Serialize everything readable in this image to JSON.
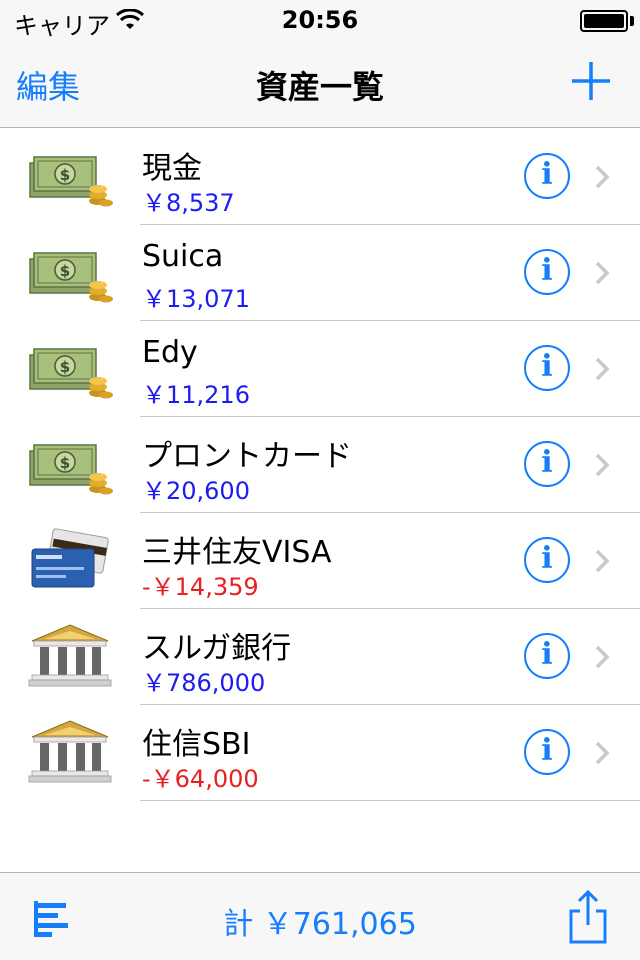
{
  "status_bar": {
    "carrier": "キャリア",
    "time": "20:56"
  },
  "nav": {
    "edit_label": "編集",
    "title": "資産一覧",
    "add_icon": "plus-icon"
  },
  "assets": [
    {
      "name": "現金",
      "amount": "￥8,537",
      "type": "cash",
      "negative": false
    },
    {
      "name": "Suica",
      "amount": "￥13,071",
      "type": "cash",
      "negative": false
    },
    {
      "name": "Edy",
      "amount": "￥11,216",
      "type": "cash",
      "negative": false
    },
    {
      "name": "プロントカード",
      "amount": "￥20,600",
      "type": "cash",
      "negative": false
    },
    {
      "name": "三井住友VISA",
      "amount": "-￥14,359",
      "type": "card",
      "negative": true
    },
    {
      "name": "スルガ銀行",
      "amount": "￥786,000",
      "type": "bank",
      "negative": false
    },
    {
      "name": "住信SBI",
      "amount": "-￥64,000",
      "type": "bank",
      "negative": true
    }
  ],
  "toolbar": {
    "total": "計 ￥761,065",
    "left_icon": "bar-list-icon",
    "right_icon": "share-icon"
  },
  "colors": {
    "accent": "#157efb",
    "positive": "#1c1cf0",
    "negative": "#e8201f"
  }
}
